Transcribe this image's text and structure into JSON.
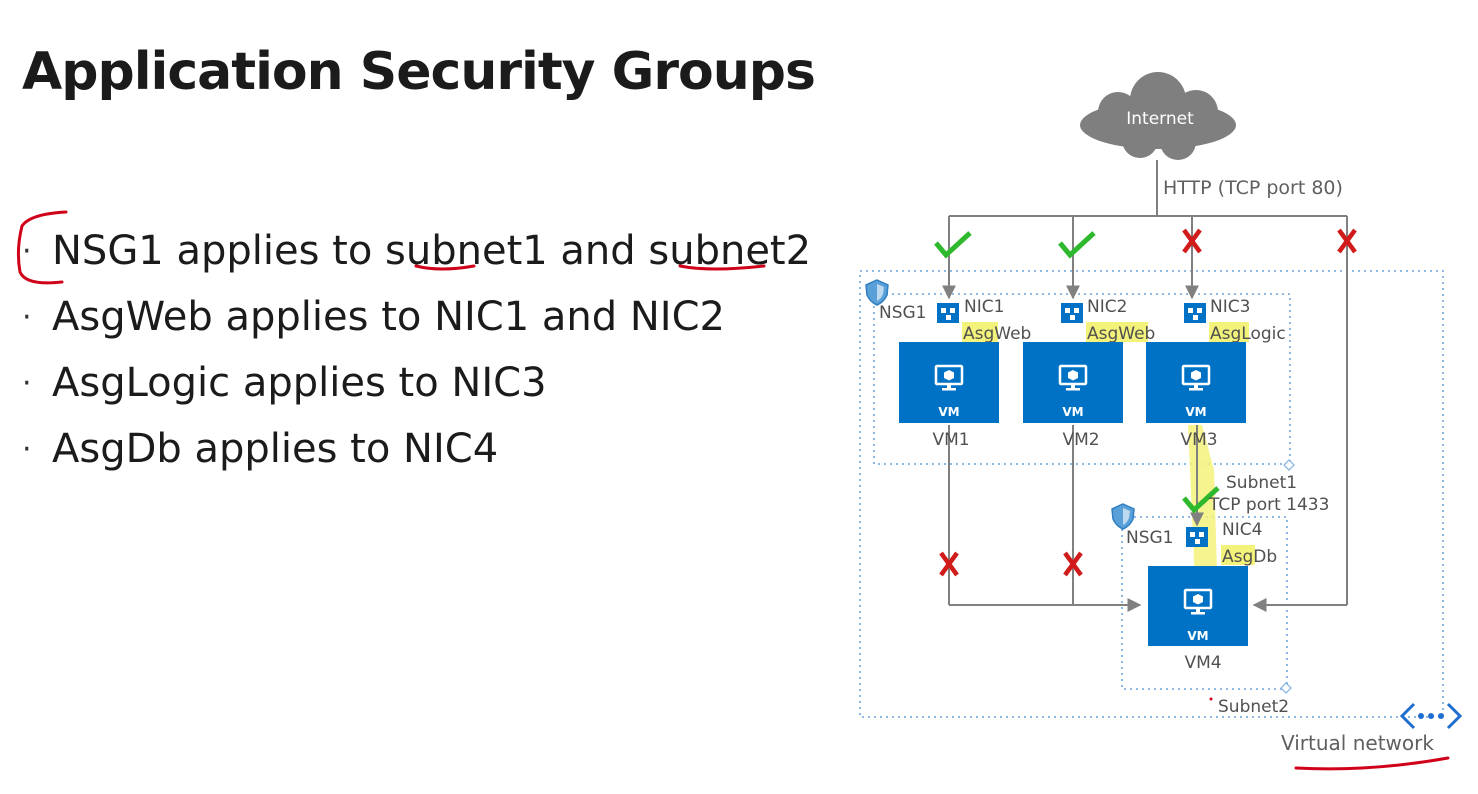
{
  "title": "Application Security Groups",
  "bullets": [
    "NSG1 applies to subnet1 and subnet2",
    "AsgWeb applies to NIC1 and NIC2",
    "AsgLogic applies to NIC3",
    "AsgDb applies to NIC4"
  ],
  "diagram": {
    "internet": "Internet",
    "http": "HTTP (TCP port 80)",
    "nsg": "NSG1",
    "vm_badge": "VM",
    "subnet1": "Subnet1",
    "subnet2": "Subnet2",
    "tcp1433": "TCP port 1433",
    "vnet": "Virtual network",
    "vms": [
      {
        "nic": "NIC1",
        "asg": "AsgWeb",
        "name": "VM1"
      },
      {
        "nic": "NIC2",
        "asg": "AsgWeb",
        "name": "VM2"
      },
      {
        "nic": "NIC3",
        "asg": "AsgLogic",
        "name": "VM3"
      },
      {
        "nic": "NIC4",
        "asg": "AsgDb",
        "name": "VM4"
      }
    ]
  },
  "colors": {
    "azure": "#0072c6",
    "allow": "#2eb82e",
    "deny": "#d11a1a",
    "highlight": "#f3f27a",
    "annotation": "#d0021b",
    "line": "#808080"
  }
}
